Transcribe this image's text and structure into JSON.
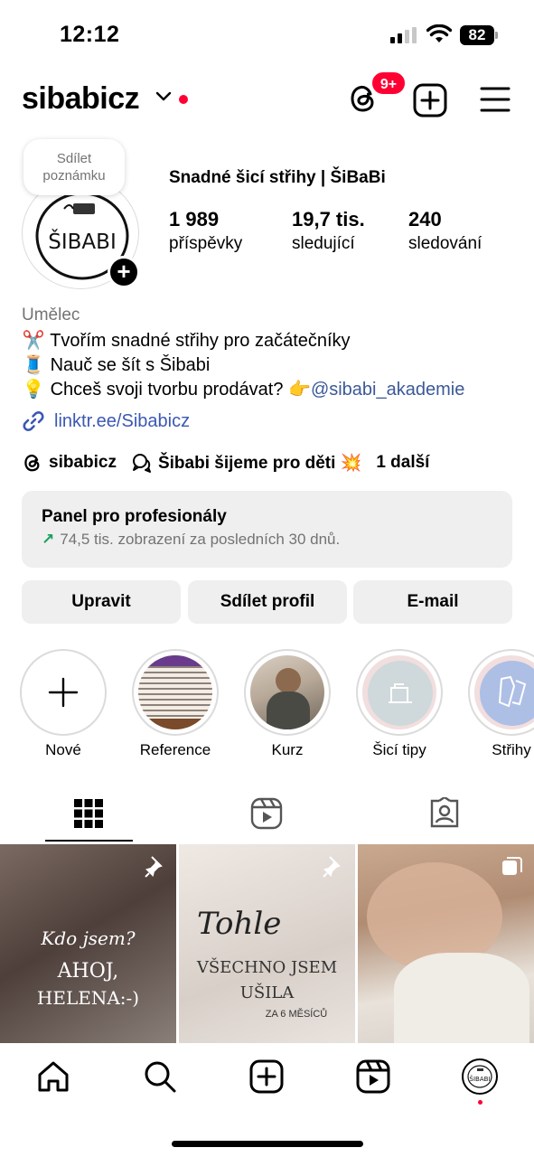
{
  "status_bar": {
    "time": "12:12",
    "battery": "82"
  },
  "header": {
    "username": "sibabicz",
    "notification_badge": "9+"
  },
  "note": {
    "line1": "Sdílet",
    "line2": "poznámku"
  },
  "profile": {
    "full_name": "Snadné šicí střihy | ŠiBaBi",
    "avatar_text": "ŠIBABI",
    "stats": [
      {
        "value": "1 989",
        "label": "příspěvky"
      },
      {
        "value": "19,7 tis.",
        "label": "sledující"
      },
      {
        "value": "240",
        "label": "sledování"
      }
    ]
  },
  "bio": {
    "category": "Umělec",
    "line1_emoji": "✂️",
    "line1": "Tvořím snadné střihy pro začátečníky",
    "line2_emoji": "🧵",
    "line2": "Nauč se šít s Šibabi",
    "line3_emoji": "💡",
    "line3": "Chceš svoji tvorbu prodávat? 👉",
    "line3_mention": "@sibabi_akademie",
    "link": "linktr.ee/Sibabicz"
  },
  "threads_row": {
    "threads_name": "sibabicz",
    "group_name": "Šibabi šijeme pro děti 💥",
    "more": "1 další"
  },
  "pro_panel": {
    "title": "Panel pro profesionály",
    "arrow": "↗",
    "subtitle": "74,5 tis. zobrazení za posledních 30 dnů."
  },
  "actions": {
    "edit": "Upravit",
    "share": "Sdílet profil",
    "email": "E-mail"
  },
  "highlights": [
    {
      "label": "Nové"
    },
    {
      "label": "Reference"
    },
    {
      "label": "Kurz"
    },
    {
      "label": "Šicí tipy"
    },
    {
      "label": "Střihy"
    }
  ],
  "posts": [
    {
      "line1": "Kdo jsem?",
      "line2": "AHOJ,",
      "line3": "HELENA:-)"
    },
    {
      "line1": "Tohle",
      "line2": "VŠECHNO JSEM",
      "line3": "UŠILA",
      "line4": "ZA 6 MĚSÍCŮ"
    },
    {}
  ],
  "colors": {
    "accent_red": "#ff0033",
    "link_blue": "#3b58b3",
    "muted_gray": "#737373",
    "button_gray": "#efefef",
    "trend_green": "#1a9e5f"
  },
  "icons": {
    "nav": [
      "home-icon",
      "search-icon",
      "create-icon",
      "reels-icon",
      "profile-icon"
    ],
    "tabs": [
      "grid-icon",
      "reels-tab-icon",
      "tagged-icon"
    ]
  }
}
